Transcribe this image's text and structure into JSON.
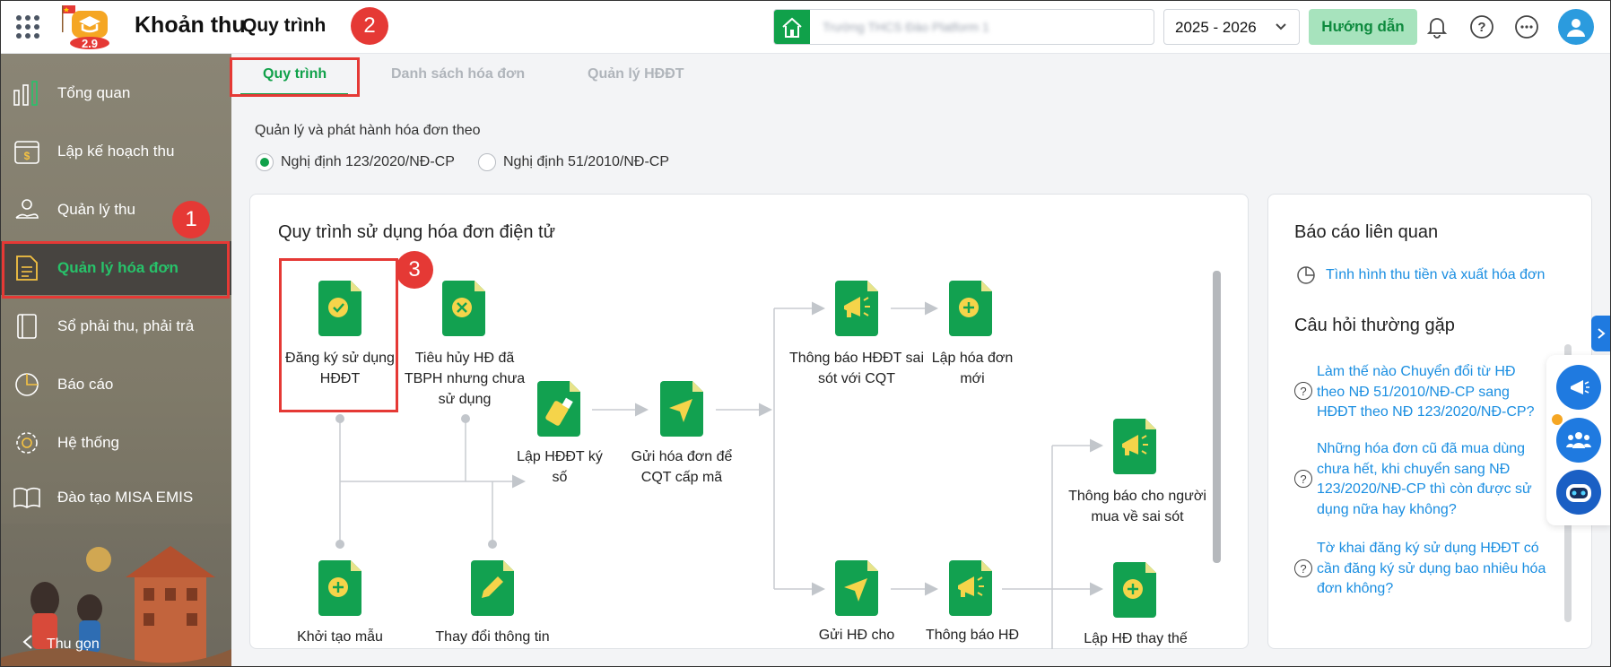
{
  "header": {
    "app_title": "Khoản thu",
    "page_title": "Quy trình",
    "school_name": "Trường THCS Đào Platform 1",
    "school_year": "2025 - 2026",
    "guide_label": "Hướng dẫn",
    "logo_text": "2.9",
    "accent_color": "#10a14a"
  },
  "sidebar": {
    "items": [
      {
        "label": "Tổng quan",
        "icon": "bar-chart-icon"
      },
      {
        "label": "Lập kế hoạch thu",
        "icon": "calendar-money-icon"
      },
      {
        "label": "Quản lý thu",
        "icon": "hand-coin-icon"
      },
      {
        "label": "Quản lý hóa đơn",
        "icon": "invoice-document-icon",
        "active": true
      },
      {
        "label": "Sổ phải thu, phải trả",
        "icon": "ledger-book-icon"
      },
      {
        "label": "Báo cáo",
        "icon": "pie-chart-icon"
      },
      {
        "label": "Hệ thống",
        "icon": "gear-icon"
      },
      {
        "label": "Đào tạo MISA EMIS",
        "icon": "open-book-icon"
      }
    ],
    "collapse_label": "Thu gọn"
  },
  "tabs": [
    {
      "label": "Quy trình",
      "active": true
    },
    {
      "label": "Danh sách hóa đơn"
    },
    {
      "label": "Quản lý HĐĐT"
    }
  ],
  "annotations": [
    "1",
    "2",
    "3"
  ],
  "decree": {
    "label": "Quản lý và phát hành hóa đơn theo",
    "options": [
      {
        "label": "Nghị định 123/2020/NĐ-CP",
        "selected": true
      },
      {
        "label": "Nghị định 51/2010/NĐ-CP",
        "selected": false
      }
    ]
  },
  "workflow": {
    "title": "Quy trình sử dụng hóa đơn điện tử",
    "steps": [
      {
        "label": "Đăng ký sử dụng HĐĐT",
        "icon": "check-doc-icon"
      },
      {
        "label": "Tiêu hủy HĐ đã TBPH nhưng chưa sử dụng",
        "icon": "cancel-doc-icon"
      },
      {
        "label": "Lập HĐĐT ký số",
        "icon": "usb-token-doc-icon"
      },
      {
        "label": "Gửi hóa đơn để CQT cấp mã",
        "icon": "send-doc-icon"
      },
      {
        "label": "Thông báo HĐĐT sai sót với CQT",
        "icon": "megaphone-doc-icon"
      },
      {
        "label": "Lập hóa đơn mới",
        "icon": "plus-doc-icon"
      },
      {
        "label": "Thông báo cho người mua về sai sót",
        "icon": "megaphone-doc-icon"
      },
      {
        "label": "Khởi tạo mẫu",
        "icon": "plus-doc-icon"
      },
      {
        "label": "Thay đổi thông tin",
        "icon": "edit-doc-icon"
      },
      {
        "label": "Gửi HĐ cho",
        "icon": "send-doc-icon"
      },
      {
        "label": "Thông báo HĐ",
        "icon": "megaphone-doc-icon"
      },
      {
        "label": "Lập HĐ thay thế",
        "icon": "plus-doc-icon"
      }
    ]
  },
  "related": {
    "title": "Báo cáo liên quan",
    "report_link": "Tình hình thu tiền và xuất hóa đơn",
    "faq_title": "Câu hỏi thường gặp",
    "faqs": [
      "Làm thế nào Chuyển đổi từ HĐ theo NĐ 51/2010/NĐ-CP sang HĐĐT theo NĐ 123/2020/NĐ-CP?",
      "Những hóa đơn cũ đã mua dùng chưa hết, khi chuyển sang NĐ 123/2020/NĐ-CP thì còn được sử dụng nữa hay không?",
      "Tờ khai đăng ký sử dụng HĐĐT có cần đăng ký sử dụng bao nhiêu hóa đơn không?"
    ]
  }
}
